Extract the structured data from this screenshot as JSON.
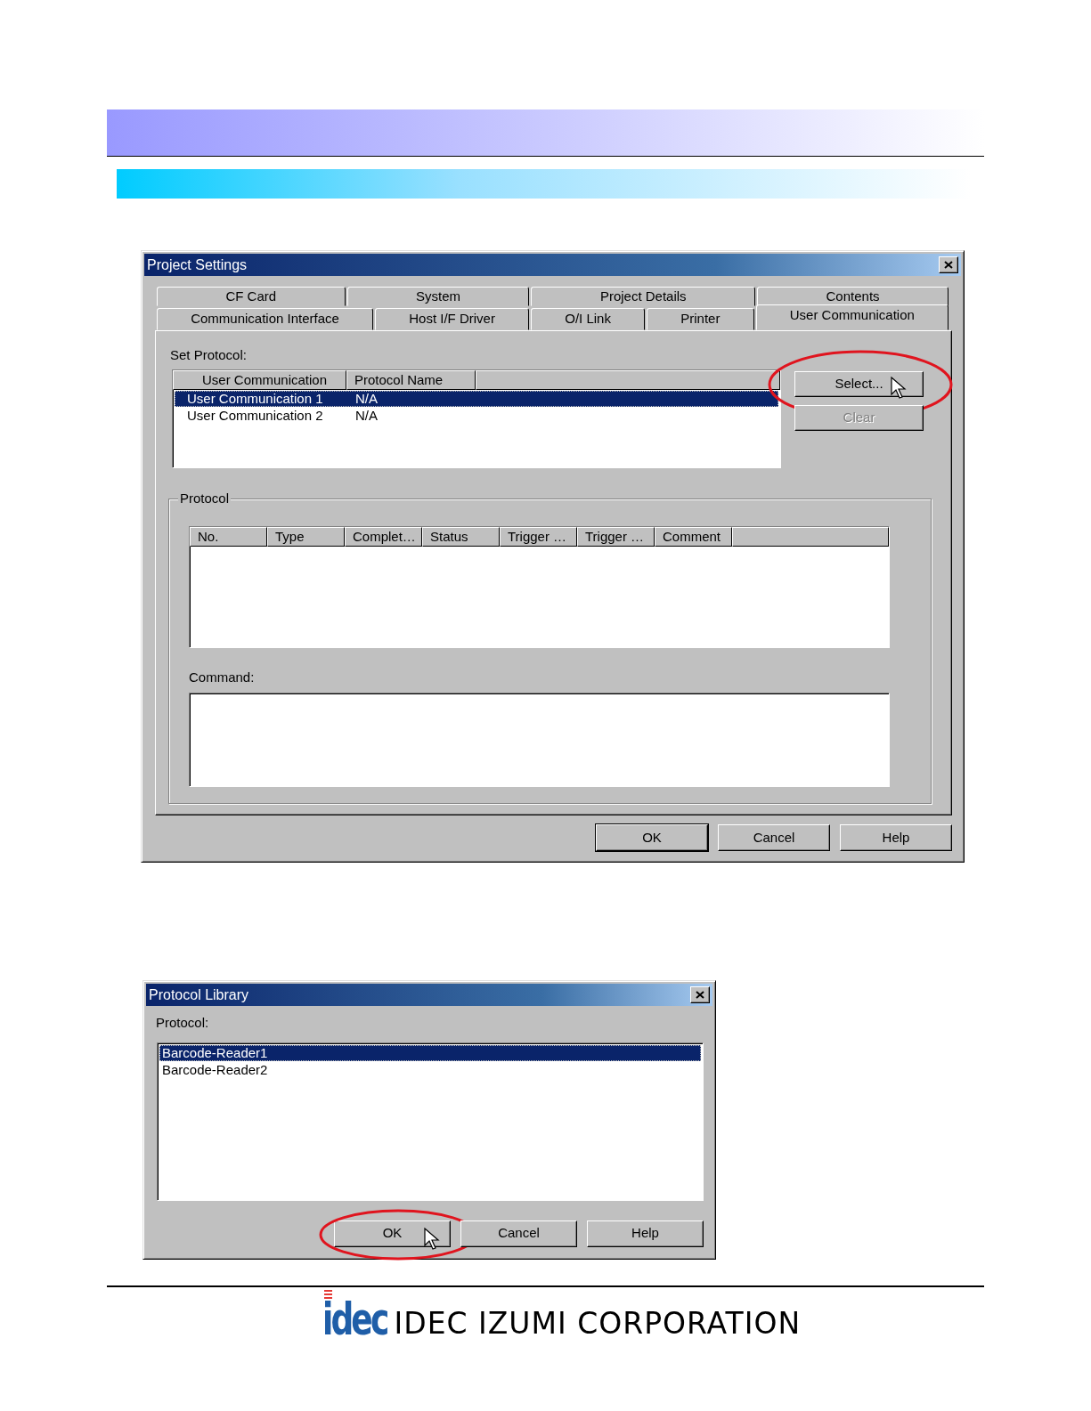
{
  "project_settings": {
    "title": "Project Settings",
    "tab_rows": [
      [
        {
          "label": "CF Card",
          "selected": false
        },
        {
          "label": "System",
          "selected": false
        },
        {
          "label": "Project Details",
          "selected": false
        },
        {
          "label": "Contents",
          "selected": false
        }
      ],
      [
        {
          "label": "Communication Interface",
          "selected": false
        },
        {
          "label": "Host I/F Driver",
          "selected": false
        },
        {
          "label": "O/I Link",
          "selected": false
        },
        {
          "label": "Printer",
          "selected": false
        },
        {
          "label": "User Communication",
          "selected": true
        }
      ]
    ],
    "set_protocol_label": "Set Protocol:",
    "comm_list": {
      "columns": [
        "User Communication",
        "Protocol Name"
      ],
      "rows": [
        {
          "cells": [
            "User Communication 1",
            "N/A"
          ],
          "selected": true
        },
        {
          "cells": [
            "User Communication 2",
            "N/A"
          ],
          "selected": false
        }
      ]
    },
    "side_buttons": [
      {
        "label": "Select...",
        "disabled": false,
        "annotated": true
      },
      {
        "label": "Clear",
        "disabled": true,
        "annotated": false
      }
    ],
    "protocol_group": {
      "label": "Protocol",
      "columns": [
        "No.",
        "Type",
        "Complet…",
        "Status",
        "Trigger …",
        "Trigger …",
        "Comment"
      ],
      "command_label": "Command:"
    },
    "buttons": [
      {
        "label": "OK",
        "default": true
      },
      {
        "label": "Cancel",
        "default": false
      },
      {
        "label": "Help",
        "default": false
      }
    ]
  },
  "protocol_library": {
    "title": "Protocol Library",
    "label": "Protocol:",
    "items": [
      {
        "text": "Barcode-Reader1",
        "selected": true
      },
      {
        "text": "Barcode-Reader2",
        "selected": false
      }
    ],
    "buttons": [
      {
        "label": "OK",
        "annotated": true
      },
      {
        "label": "Cancel",
        "annotated": false
      },
      {
        "label": "Help",
        "annotated": false
      }
    ]
  },
  "footer": {
    "logo": "idec",
    "company": "IDEC IZUMI CORPORATION"
  }
}
